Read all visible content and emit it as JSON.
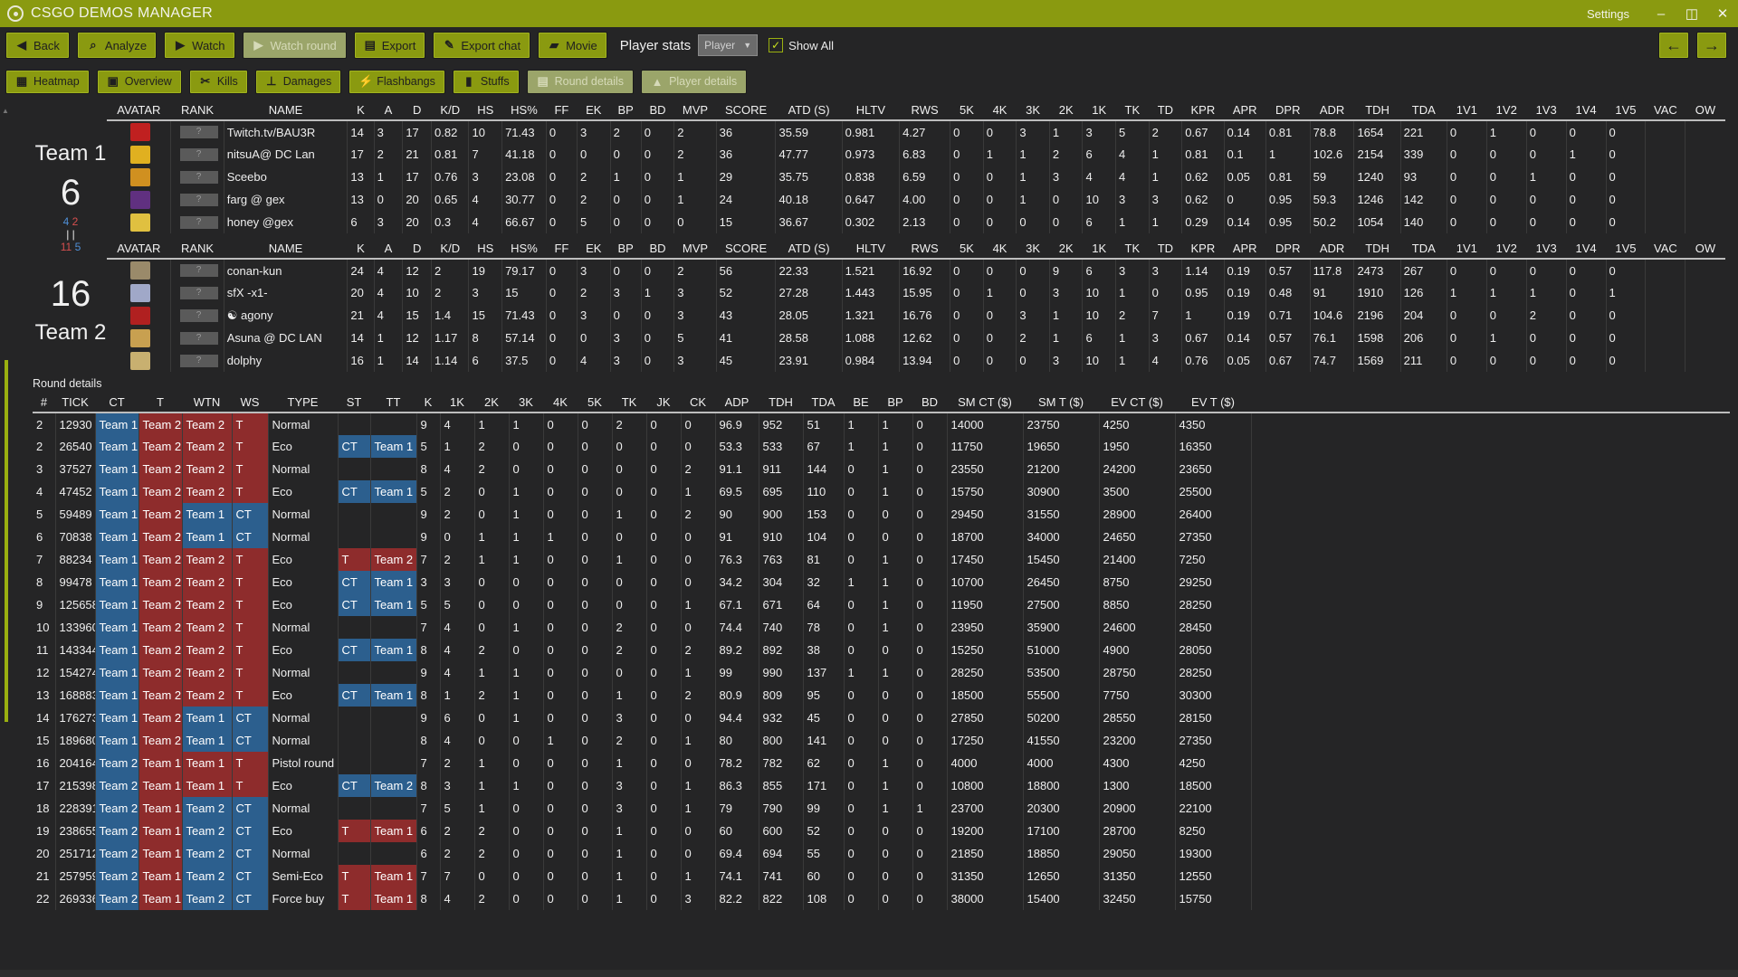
{
  "window": {
    "title": "CSGO DEMOS MANAGER",
    "settings": "Settings",
    "minimize": "–",
    "restore": "◫",
    "close": "✕"
  },
  "toolbar": {
    "buttons": [
      {
        "label": "Back",
        "icon": "◀",
        "disabled": false
      },
      {
        "label": "Analyze",
        "icon": "⌕",
        "disabled": false
      },
      {
        "label": "Watch",
        "icon": "▶",
        "disabled": false
      },
      {
        "label": "Watch round",
        "icon": "▶",
        "disabled": true
      },
      {
        "label": "Export",
        "icon": "▤",
        "disabled": false
      },
      {
        "label": "Export chat",
        "icon": "✎",
        "disabled": false
      },
      {
        "label": "Movie",
        "icon": "▰",
        "disabled": false
      }
    ],
    "player_stats_label": "Player stats",
    "player_select": "Player",
    "show_all": "Show All",
    "prev_arrow": "←",
    "next_arrow": "→"
  },
  "toolbar2": {
    "buttons": [
      {
        "label": "Heatmap",
        "icon": "▦",
        "disabled": false
      },
      {
        "label": "Overview",
        "icon": "▣",
        "disabled": false
      },
      {
        "label": "Kills",
        "icon": "✂",
        "disabled": false
      },
      {
        "label": "Damages",
        "icon": "⊥",
        "disabled": false
      },
      {
        "label": "Flashbangs",
        "icon": "⚡",
        "disabled": false
      },
      {
        "label": "Stuffs",
        "icon": "▮",
        "disabled": false
      },
      {
        "label": "Round details",
        "icon": "▤",
        "disabled": true
      },
      {
        "label": "Player details",
        "icon": "▲",
        "disabled": true
      }
    ]
  },
  "teams": {
    "team1": {
      "name": "Team 1",
      "score": "6",
      "side_counts": {
        "ct": "4",
        "t": "2"
      },
      "bars": "| |",
      "side_counts2": {
        "ct": "11",
        "t": "5"
      }
    },
    "team2": {
      "name": "Team 2",
      "score": "16"
    }
  },
  "player_columns": [
    "AVATAR",
    "RANK",
    "NAME",
    "K",
    "A",
    "D",
    "K/D",
    "HS",
    "HS%",
    "FF",
    "EK",
    "BP",
    "BD",
    "MVP",
    "SCORE",
    "ATD (S)",
    "HLTV",
    "RWS",
    "5K",
    "4K",
    "3K",
    "2K",
    "1K",
    "TK",
    "TD",
    "KPR",
    "APR",
    "DPR",
    "ADR",
    "TDH",
    "TDA",
    "1V1",
    "1V2",
    "1V3",
    "1V4",
    "1V5",
    "VAC",
    "OW"
  ],
  "team1_players": [
    {
      "avatar_color": "#c02020",
      "rank": "?",
      "cells": [
        "Twitch.tv/BAU3R",
        "14",
        "3",
        "17",
        "0.82",
        "10",
        "71.43",
        "0",
        "3",
        "2",
        "0",
        "2",
        "36",
        "35.59",
        "0.981",
        "4.27",
        "0",
        "0",
        "3",
        "1",
        "3",
        "5",
        "2",
        "0.67",
        "0.14",
        "0.81",
        "78.8",
        "1654",
        "221",
        "0",
        "1",
        "0",
        "0",
        "0",
        "",
        ""
      ]
    },
    {
      "avatar_color": "#e0b020",
      "rank": "?",
      "cells": [
        "nitsuA@ DC Lan",
        "17",
        "2",
        "21",
        "0.81",
        "7",
        "41.18",
        "0",
        "0",
        "0",
        "0",
        "2",
        "36",
        "47.77",
        "0.973",
        "6.83",
        "0",
        "1",
        "1",
        "2",
        "6",
        "4",
        "1",
        "0.81",
        "0.1",
        "1",
        "102.6",
        "2154",
        "339",
        "0",
        "0",
        "0",
        "1",
        "0",
        "",
        ""
      ]
    },
    {
      "avatar_color": "#d09020",
      "rank": "?",
      "cells": [
        "Sceebo",
        "13",
        "1",
        "17",
        "0.76",
        "3",
        "23.08",
        "0",
        "2",
        "1",
        "0",
        "1",
        "29",
        "35.75",
        "0.838",
        "6.59",
        "0",
        "0",
        "1",
        "3",
        "4",
        "4",
        "1",
        "0.62",
        "0.05",
        "0.81",
        "59",
        "1240",
        "93",
        "0",
        "0",
        "1",
        "0",
        "0",
        "",
        ""
      ]
    },
    {
      "avatar_color": "#603080",
      "rank": "?",
      "cells": [
        "farg @ gex",
        "13",
        "0",
        "20",
        "0.65",
        "4",
        "30.77",
        "0",
        "2",
        "0",
        "0",
        "1",
        "24",
        "40.18",
        "0.647",
        "4.00",
        "0",
        "0",
        "1",
        "0",
        "10",
        "3",
        "3",
        "0.62",
        "0",
        "0.95",
        "59.3",
        "1246",
        "142",
        "0",
        "0",
        "0",
        "0",
        "0",
        "",
        ""
      ]
    },
    {
      "avatar_color": "#e0c040",
      "rank": "?",
      "cells": [
        "honey @gex",
        "6",
        "3",
        "20",
        "0.3",
        "4",
        "66.67",
        "0",
        "5",
        "0",
        "0",
        "0",
        "15",
        "36.67",
        "0.302",
        "2.13",
        "0",
        "0",
        "0",
        "0",
        "6",
        "1",
        "1",
        "0.29",
        "0.14",
        "0.95",
        "50.2",
        "1054",
        "140",
        "0",
        "0",
        "0",
        "0",
        "0",
        "",
        ""
      ]
    }
  ],
  "team2_players": [
    {
      "avatar_color": "#9a8a6a",
      "rank": "?",
      "cells": [
        "conan-kun",
        "24",
        "4",
        "12",
        "2",
        "19",
        "79.17",
        "0",
        "3",
        "0",
        "0",
        "2",
        "56",
        "22.33",
        "1.521",
        "16.92",
        "0",
        "0",
        "0",
        "9",
        "6",
        "3",
        "3",
        "1.14",
        "0.19",
        "0.57",
        "117.8",
        "2473",
        "267",
        "0",
        "0",
        "0",
        "0",
        "0",
        "",
        ""
      ]
    },
    {
      "avatar_color": "#a0a8c8",
      "rank": "?",
      "cells": [
        "sfX -x1-",
        "20",
        "4",
        "10",
        "2",
        "3",
        "15",
        "0",
        "2",
        "3",
        "1",
        "3",
        "52",
        "27.28",
        "1.443",
        "15.95",
        "0",
        "1",
        "0",
        "3",
        "10",
        "1",
        "0",
        "0.95",
        "0.19",
        "0.48",
        "91",
        "1910",
        "126",
        "1",
        "1",
        "1",
        "0",
        "1",
        "",
        ""
      ]
    },
    {
      "avatar_color": "#b02020",
      "rank": "?",
      "cells": [
        "☯ agony",
        "21",
        "4",
        "15",
        "1.4",
        "15",
        "71.43",
        "0",
        "3",
        "0",
        "0",
        "3",
        "43",
        "28.05",
        "1.321",
        "16.76",
        "0",
        "0",
        "3",
        "1",
        "10",
        "2",
        "7",
        "1",
        "0.19",
        "0.71",
        "104.6",
        "2196",
        "204",
        "0",
        "0",
        "2",
        "0",
        "0",
        "",
        ""
      ]
    },
    {
      "avatar_color": "#c8a050",
      "rank": "?",
      "cells": [
        "Asuna @ DC LAN",
        "14",
        "1",
        "12",
        "1.17",
        "8",
        "57.14",
        "0",
        "0",
        "3",
        "0",
        "5",
        "41",
        "28.58",
        "1.088",
        "12.62",
        "0",
        "0",
        "2",
        "1",
        "6",
        "1",
        "3",
        "0.67",
        "0.14",
        "0.57",
        "76.1",
        "1598",
        "206",
        "0",
        "1",
        "0",
        "0",
        "0",
        "",
        ""
      ]
    },
    {
      "avatar_color": "#c8b070",
      "rank": "?",
      "cells": [
        "dolphy",
        "16",
        "1",
        "14",
        "1.14",
        "6",
        "37.5",
        "0",
        "4",
        "3",
        "0",
        "3",
        "45",
        "23.91",
        "0.984",
        "13.94",
        "0",
        "0",
        "0",
        "3",
        "10",
        "1",
        "4",
        "0.76",
        "0.05",
        "0.67",
        "74.7",
        "1569",
        "211",
        "0",
        "0",
        "0",
        "0",
        "0",
        "",
        ""
      ]
    }
  ],
  "round_details_label": "Round details",
  "round_columns": [
    "#",
    "TICK",
    "CT",
    "T",
    "WTN",
    "WS",
    "TYPE",
    "ST",
    "TT",
    "K",
    "1K",
    "2K",
    "3K",
    "4K",
    "5K",
    "TK",
    "JK",
    "CK",
    "ADP",
    "TDH",
    "TDA",
    "BE",
    "BP",
    "BD",
    "SM CT ($)",
    "SM T ($)",
    "EV CT ($)",
    "EV T ($)"
  ],
  "rounds": [
    [
      "2",
      "12930",
      "Team 1",
      "Team 2",
      "Team 2",
      "T",
      "Normal",
      "",
      "",
      "9",
      "4",
      "1",
      "1",
      "0",
      "0",
      "2",
      "0",
      "0",
      "96.9",
      "952",
      "51",
      "1",
      "1",
      "0",
      "14000",
      "23750",
      "4250",
      "4350"
    ],
    [
      "2",
      "26540",
      "Team 1",
      "Team 2",
      "Team 2",
      "T",
      "Eco",
      "CT",
      "Team 1",
      "5",
      "1",
      "2",
      "0",
      "0",
      "0",
      "0",
      "0",
      "0",
      "53.3",
      "533",
      "67",
      "1",
      "1",
      "0",
      "11750",
      "19650",
      "1950",
      "16350"
    ],
    [
      "3",
      "37527",
      "Team 1",
      "Team 2",
      "Team 2",
      "T",
      "Normal",
      "",
      "",
      "8",
      "4",
      "2",
      "0",
      "0",
      "0",
      "0",
      "0",
      "2",
      "91.1",
      "911",
      "144",
      "0",
      "1",
      "0",
      "23550",
      "21200",
      "24200",
      "23650"
    ],
    [
      "4",
      "47452",
      "Team 1",
      "Team 2",
      "Team 2",
      "T",
      "Eco",
      "CT",
      "Team 1",
      "5",
      "2",
      "0",
      "1",
      "0",
      "0",
      "0",
      "0",
      "1",
      "69.5",
      "695",
      "110",
      "0",
      "1",
      "0",
      "15750",
      "30900",
      "3500",
      "25500"
    ],
    [
      "5",
      "59489",
      "Team 1",
      "Team 2",
      "Team 1",
      "CT",
      "Normal",
      "",
      "",
      "9",
      "2",
      "0",
      "1",
      "0",
      "0",
      "1",
      "0",
      "2",
      "90",
      "900",
      "153",
      "0",
      "0",
      "0",
      "29450",
      "31550",
      "28900",
      "26400"
    ],
    [
      "6",
      "70838",
      "Team 1",
      "Team 2",
      "Team 1",
      "CT",
      "Normal",
      "",
      "",
      "9",
      "0",
      "1",
      "1",
      "1",
      "0",
      "0",
      "0",
      "0",
      "91",
      "910",
      "104",
      "0",
      "0",
      "0",
      "18700",
      "34000",
      "24650",
      "27350"
    ],
    [
      "7",
      "88234",
      "Team 1",
      "Team 2",
      "Team 2",
      "T",
      "Eco",
      "T",
      "Team 2",
      "7",
      "2",
      "1",
      "1",
      "0",
      "0",
      "1",
      "0",
      "0",
      "76.3",
      "763",
      "81",
      "0",
      "1",
      "0",
      "17450",
      "15450",
      "21400",
      "7250"
    ],
    [
      "8",
      "99478",
      "Team 1",
      "Team 2",
      "Team 2",
      "T",
      "Eco",
      "CT",
      "Team 1",
      "3",
      "3",
      "0",
      "0",
      "0",
      "0",
      "0",
      "0",
      "0",
      "34.2",
      "304",
      "32",
      "1",
      "1",
      "0",
      "10700",
      "26450",
      "8750",
      "29250"
    ],
    [
      "9",
      "125658",
      "Team 1",
      "Team 2",
      "Team 2",
      "T",
      "Eco",
      "CT",
      "Team 1",
      "5",
      "5",
      "0",
      "0",
      "0",
      "0",
      "0",
      "0",
      "1",
      "67.1",
      "671",
      "64",
      "0",
      "1",
      "0",
      "11950",
      "27500",
      "8850",
      "28250"
    ],
    [
      "10",
      "133960",
      "Team 1",
      "Team 2",
      "Team 2",
      "T",
      "Normal",
      "",
      "",
      "7",
      "4",
      "0",
      "1",
      "0",
      "0",
      "2",
      "0",
      "0",
      "74.4",
      "740",
      "78",
      "0",
      "1",
      "0",
      "23950",
      "35900",
      "24600",
      "28450"
    ],
    [
      "11",
      "143344",
      "Team 1",
      "Team 2",
      "Team 2",
      "T",
      "Eco",
      "CT",
      "Team 1",
      "8",
      "4",
      "2",
      "0",
      "0",
      "0",
      "2",
      "0",
      "2",
      "89.2",
      "892",
      "38",
      "0",
      "0",
      "0",
      "15250",
      "51000",
      "4900",
      "28050"
    ],
    [
      "12",
      "154274",
      "Team 1",
      "Team 2",
      "Team 2",
      "T",
      "Normal",
      "",
      "",
      "9",
      "4",
      "1",
      "1",
      "0",
      "0",
      "0",
      "0",
      "1",
      "99",
      "990",
      "137",
      "1",
      "1",
      "0",
      "28250",
      "53500",
      "28750",
      "28250"
    ],
    [
      "13",
      "168883",
      "Team 1",
      "Team 2",
      "Team 2",
      "T",
      "Eco",
      "CT",
      "Team 1",
      "8",
      "1",
      "2",
      "1",
      "0",
      "0",
      "1",
      "0",
      "2",
      "80.9",
      "809",
      "95",
      "0",
      "0",
      "0",
      "18500",
      "55500",
      "7750",
      "30300"
    ],
    [
      "14",
      "176273",
      "Team 1",
      "Team 2",
      "Team 1",
      "CT",
      "Normal",
      "",
      "",
      "9",
      "6",
      "0",
      "1",
      "0",
      "0",
      "3",
      "0",
      "0",
      "94.4",
      "932",
      "45",
      "0",
      "0",
      "0",
      "27850",
      "50200",
      "28550",
      "28150"
    ],
    [
      "15",
      "189680",
      "Team 1",
      "Team 2",
      "Team 1",
      "CT",
      "Normal",
      "",
      "",
      "8",
      "4",
      "0",
      "0",
      "1",
      "0",
      "2",
      "0",
      "1",
      "80",
      "800",
      "141",
      "0",
      "0",
      "0",
      "17250",
      "41550",
      "23200",
      "27350"
    ],
    [
      "16",
      "204164",
      "Team 2",
      "Team 1",
      "Team 1",
      "T",
      "Pistol round",
      "",
      "",
      "7",
      "2",
      "1",
      "0",
      "0",
      "0",
      "1",
      "0",
      "0",
      "78.2",
      "782",
      "62",
      "0",
      "1",
      "0",
      "4000",
      "4000",
      "4300",
      "4250"
    ],
    [
      "17",
      "215398",
      "Team 2",
      "Team 1",
      "Team 1",
      "T",
      "Eco",
      "CT",
      "Team 2",
      "8",
      "3",
      "1",
      "1",
      "0",
      "0",
      "3",
      "0",
      "1",
      "86.3",
      "855",
      "171",
      "0",
      "1",
      "0",
      "10800",
      "18800",
      "1300",
      "18500"
    ],
    [
      "18",
      "228391",
      "Team 2",
      "Team 1",
      "Team 2",
      "CT",
      "Normal",
      "",
      "",
      "7",
      "5",
      "1",
      "0",
      "0",
      "0",
      "3",
      "0",
      "1",
      "79",
      "790",
      "99",
      "0",
      "1",
      "1",
      "23700",
      "20300",
      "20900",
      "22100"
    ],
    [
      "19",
      "238655",
      "Team 2",
      "Team 1",
      "Team 2",
      "CT",
      "Eco",
      "T",
      "Team 1",
      "6",
      "2",
      "2",
      "0",
      "0",
      "0",
      "1",
      "0",
      "0",
      "60",
      "600",
      "52",
      "0",
      "0",
      "0",
      "19200",
      "17100",
      "28700",
      "8250"
    ],
    [
      "20",
      "251712",
      "Team 2",
      "Team 1",
      "Team 2",
      "CT",
      "Normal",
      "",
      "",
      "6",
      "2",
      "2",
      "0",
      "0",
      "0",
      "1",
      "0",
      "0",
      "69.4",
      "694",
      "55",
      "0",
      "0",
      "0",
      "21850",
      "18850",
      "29050",
      "19300"
    ],
    [
      "21",
      "257959",
      "Team 2",
      "Team 1",
      "Team 2",
      "CT",
      "Semi-Eco",
      "T",
      "Team 1",
      "7",
      "7",
      "0",
      "0",
      "0",
      "0",
      "1",
      "0",
      "1",
      "74.1",
      "741",
      "60",
      "0",
      "0",
      "0",
      "31350",
      "12650",
      "31350",
      "12550"
    ],
    [
      "22",
      "269336",
      "Team 2",
      "Team 1",
      "Team 2",
      "CT",
      "Force buy",
      "T",
      "Team 1",
      "8",
      "4",
      "2",
      "0",
      "0",
      "0",
      "1",
      "0",
      "3",
      "82.2",
      "822",
      "108",
      "0",
      "0",
      "0",
      "38000",
      "15400",
      "32450",
      "15750"
    ]
  ],
  "colors": {
    "accent": "#8a9a10",
    "ct": "#2c5f8e",
    "t": "#8e2c2c",
    "background": "#252526"
  }
}
